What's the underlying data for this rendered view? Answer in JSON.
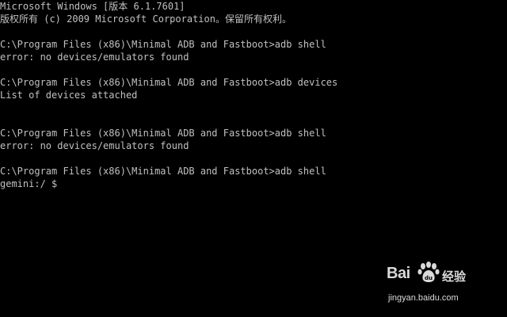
{
  "window": {
    "background": "#000000",
    "text_color": "#c0c0c0"
  },
  "console": {
    "lines": [
      "Microsoft Windows [版本 6.1.7601]",
      "版权所有 (c) 2009 Microsoft Corporation。保留所有权利。",
      "",
      "C:\\Program Files (x86)\\Minimal ADB and Fastboot>adb shell",
      "error: no devices/emulators found",
      "",
      "C:\\Program Files (x86)\\Minimal ADB and Fastboot>adb devices",
      "List of devices attached",
      "",
      "",
      "C:\\Program Files (x86)\\Minimal ADB and Fastboot>adb shell",
      "error: no devices/emulators found",
      "",
      "C:\\Program Files (x86)\\Minimal ADB and Fastboot>adb shell"
    ],
    "prompt": "gemini:/ $ "
  },
  "watermark": {
    "brand": "Bai",
    "brand_suffix": "经验",
    "url": "jingyan.baidu.com",
    "icon": "baidu-paw-icon"
  }
}
